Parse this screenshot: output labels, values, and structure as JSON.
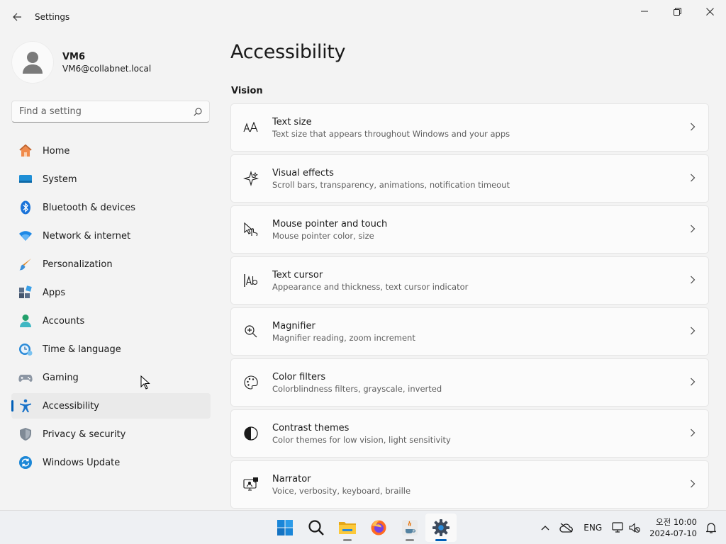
{
  "window": {
    "title": "Settings",
    "controls": [
      "minimize",
      "maximize",
      "close"
    ]
  },
  "profile": {
    "name": "VM6",
    "email": "VM6@collabnet.local"
  },
  "search": {
    "placeholder": "Find a setting",
    "value": ""
  },
  "nav": [
    {
      "label": "Home",
      "icon": "home-icon",
      "active": false
    },
    {
      "label": "System",
      "icon": "system-icon",
      "active": false
    },
    {
      "label": "Bluetooth & devices",
      "icon": "bluetooth-icon",
      "active": false
    },
    {
      "label": "Network & internet",
      "icon": "wifi-icon",
      "active": false
    },
    {
      "label": "Personalization",
      "icon": "brush-icon",
      "active": false
    },
    {
      "label": "Apps",
      "icon": "apps-icon",
      "active": false
    },
    {
      "label": "Accounts",
      "icon": "accounts-icon",
      "active": false
    },
    {
      "label": "Time & language",
      "icon": "time-language-icon",
      "active": false
    },
    {
      "label": "Gaming",
      "icon": "gamepad-icon",
      "active": false
    },
    {
      "label": "Accessibility",
      "icon": "accessibility-icon",
      "active": true
    },
    {
      "label": "Privacy & security",
      "icon": "shield-icon",
      "active": false
    },
    {
      "label": "Windows Update",
      "icon": "update-icon",
      "active": false
    }
  ],
  "main": {
    "title": "Accessibility",
    "section": "Vision",
    "cards": [
      {
        "title": "Text size",
        "subtitle": "Text size that appears throughout Windows and your apps",
        "icon": "text-size-icon"
      },
      {
        "title": "Visual effects",
        "subtitle": "Scroll bars, transparency, animations, notification timeout",
        "icon": "sparkle-icon"
      },
      {
        "title": "Mouse pointer and touch",
        "subtitle": "Mouse pointer color, size",
        "icon": "pointer-touch-icon"
      },
      {
        "title": "Text cursor",
        "subtitle": "Appearance and thickness, text cursor indicator",
        "icon": "text-cursor-icon"
      },
      {
        "title": "Magnifier",
        "subtitle": "Magnifier reading, zoom increment",
        "icon": "magnifier-icon"
      },
      {
        "title": "Color filters",
        "subtitle": "Colorblindness filters, grayscale, inverted",
        "icon": "palette-icon"
      },
      {
        "title": "Contrast themes",
        "subtitle": "Color themes for low vision, light sensitivity",
        "icon": "contrast-icon"
      },
      {
        "title": "Narrator",
        "subtitle": "Voice, verbosity, keyboard, braille",
        "icon": "narrator-icon"
      }
    ]
  },
  "taskbar": {
    "apps": [
      {
        "name": "Start",
        "icon": "windows-start-icon"
      },
      {
        "name": "Search",
        "icon": "search-icon"
      },
      {
        "name": "File Explorer",
        "icon": "folder-icon"
      },
      {
        "name": "Firefox",
        "icon": "firefox-icon"
      },
      {
        "name": "Java",
        "icon": "java-icon"
      },
      {
        "name": "Settings",
        "icon": "settings-gear-icon"
      }
    ],
    "tray": {
      "language": "ENG",
      "time": "오전 10:00",
      "date": "2024-07-10"
    }
  },
  "colors": {
    "accent": "#005fb8",
    "background": "#f3f3f3",
    "card": "#fbfbfb"
  }
}
